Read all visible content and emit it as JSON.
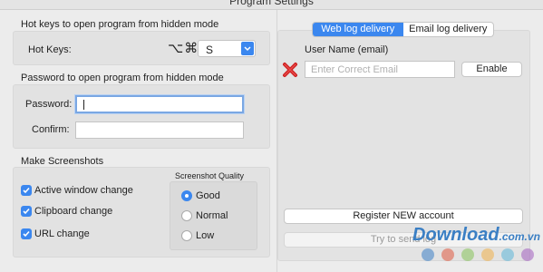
{
  "window": {
    "title": "Program Settings"
  },
  "hotkeys": {
    "group_title": "Hot keys to open program from hidden mode",
    "label": "Hot Keys:",
    "modifiers": "⌥⌘",
    "key_value": "S"
  },
  "password": {
    "group_title": "Password to open program from hidden mode",
    "password_label": "Password:",
    "password_value": "",
    "confirm_label": "Confirm:",
    "confirm_value": ""
  },
  "screenshots": {
    "group_title": "Make Screenshots",
    "options": [
      {
        "label": "Active window change",
        "checked": true
      },
      {
        "label": "Clipboard change",
        "checked": true
      },
      {
        "label": "URL change",
        "checked": true
      }
    ],
    "quality": {
      "title": "Screenshot Quality",
      "options": [
        {
          "label": "Good",
          "selected": true
        },
        {
          "label": "Normal",
          "selected": false
        },
        {
          "label": "Low",
          "selected": false
        }
      ]
    }
  },
  "delivery": {
    "tabs": [
      {
        "label": "Web log delivery",
        "active": true
      },
      {
        "label": "Email log delivery",
        "active": false
      }
    ],
    "user_name_label": "User Name (email)",
    "email_placeholder": "Enter Correct Email",
    "enable_label": "Enable",
    "register_label": "Register NEW account",
    "try_send_label": "Try to send log"
  },
  "watermark": {
    "text": "Download",
    "domain": ".com.vn",
    "dot_colors": [
      "#3d7fc6",
      "#e0593f",
      "#86c35a",
      "#f1b04a",
      "#5cb7d9",
      "#a35ec0"
    ]
  },
  "colors": {
    "accent": "#3b87ef",
    "error": "#cc1f1f"
  }
}
